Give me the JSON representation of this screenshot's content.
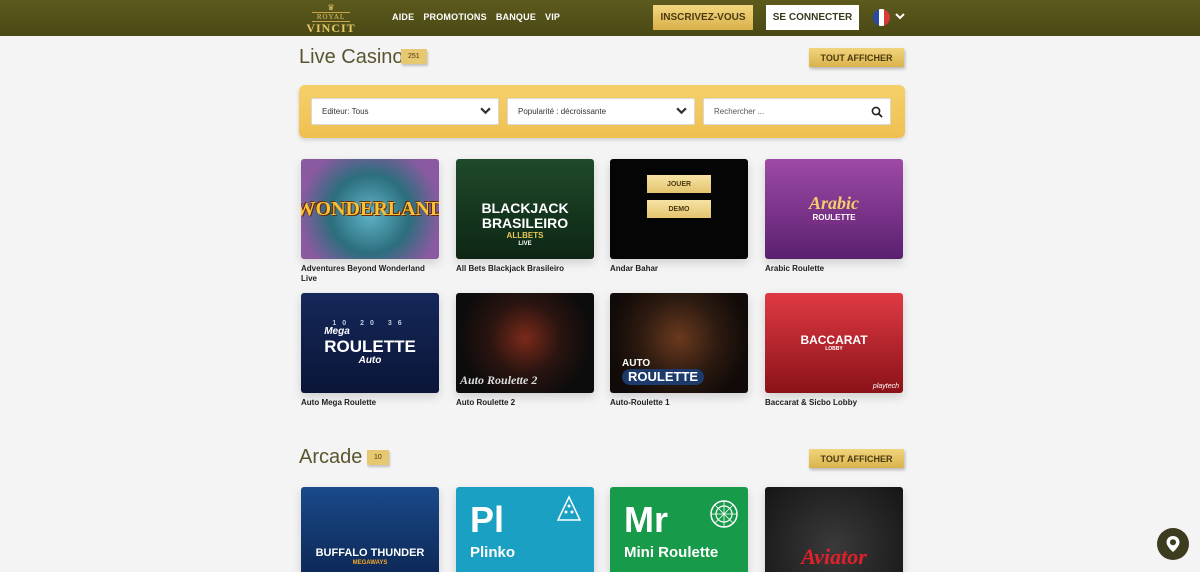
{
  "header": {
    "logo": {
      "line1": "ROYAL",
      "line2": "VINCIT"
    },
    "nav": [
      "AIDE",
      "PROMOTIONS",
      "BANQUE",
      "VIP"
    ],
    "signup_label": "INSCRIVEZ-VOUS",
    "login_label": "SE CONNECTER",
    "language_flag": "fr-flag-icon"
  },
  "live_casino": {
    "title": "Live Casino",
    "count": "251",
    "show_all": "TOUT AFFICHER",
    "filters": {
      "publisher": "Editeur: Tous",
      "sort": "Popularité : décroissante",
      "search_placeholder": "Rechercher ..."
    },
    "games": [
      {
        "name": "Adventures Beyond Wonderland Live",
        "art": "WONDERLAND"
      },
      {
        "name": "All Bets Blackjack Brasileiro",
        "art_line1": "BLACKJACK",
        "art_line2": "BRASILEIRO",
        "art_line3": "ALLBETS",
        "art_line4": "LIVE"
      },
      {
        "name": "Andar Bahar",
        "play": "JOUER",
        "demo": "DEMO"
      },
      {
        "name": "Arabic Roulette",
        "art_line1": "Arabic",
        "art_line2": "ROULETTE"
      },
      {
        "name": "Auto Mega Roulette",
        "art_line1": "Mega",
        "art_line2": "ROULETTE",
        "art_line3": "Auto",
        "art_nums": [
          "10",
          "20",
          "36"
        ]
      },
      {
        "name": "Auto Roulette 2",
        "art": "Auto Roulette 2"
      },
      {
        "name": "Auto-Roulette 1",
        "art_line1": "AUTO",
        "art_line2": "ROULETTE"
      },
      {
        "name": "Baccarat & Sicbo Lobby",
        "art_line1": "BACCARAT",
        "art_line2": "LOBBY",
        "art_line3": "playtech"
      }
    ]
  },
  "arcade": {
    "title": "Arcade",
    "count": "10",
    "show_all": "TOUT AFFICHER",
    "games": [
      {
        "art_line1": "BUFFALO THUNDER",
        "art_line2": "MEGAWAYS"
      },
      {
        "symbol": "Pl",
        "label": "Plinko"
      },
      {
        "symbol": "Mr",
        "label": "Mini Roulette"
      },
      {
        "art": "Aviator"
      }
    ]
  },
  "colors": {
    "header": "#4f4e18",
    "gold": "#efc050",
    "title": "#5a5530"
  }
}
